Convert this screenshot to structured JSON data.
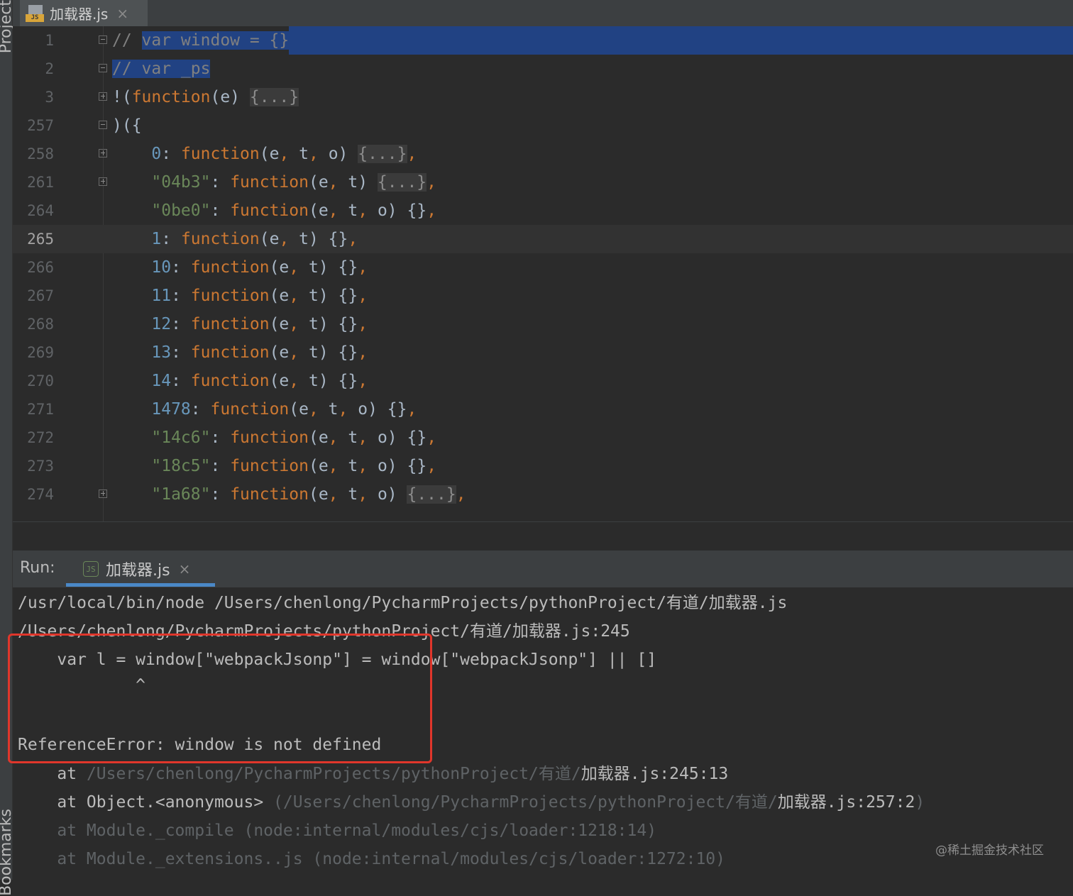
{
  "sidebar": {
    "project_label": "Project",
    "bookmarks_label": "Bookmarks"
  },
  "editor_tab": {
    "icon": "js-file-icon",
    "icon_badge": "JS",
    "filename": "加载器.js"
  },
  "editor": {
    "lines": [
      {
        "num": "1",
        "fold": "minus"
      },
      {
        "num": "2",
        "fold": "minus"
      },
      {
        "num": "3",
        "fold": "plus"
      },
      {
        "num": "257",
        "fold": "minus"
      },
      {
        "num": "258",
        "fold": "plus"
      },
      {
        "num": "261",
        "fold": "plus"
      },
      {
        "num": "264",
        "fold": ""
      },
      {
        "num": "265",
        "fold": "",
        "current": true
      },
      {
        "num": "266",
        "fold": ""
      },
      {
        "num": "267",
        "fold": ""
      },
      {
        "num": "268",
        "fold": ""
      },
      {
        "num": "269",
        "fold": ""
      },
      {
        "num": "270",
        "fold": ""
      },
      {
        "num": "271",
        "fold": ""
      },
      {
        "num": "272",
        "fold": ""
      },
      {
        "num": "273",
        "fold": ""
      },
      {
        "num": "274",
        "fold": "plus"
      }
    ],
    "code": {
      "l1": [
        "// ",
        "var window = {}"
      ],
      "l2": [
        "// var _ps"
      ],
      "l3": [
        "!(",
        "function",
        "(e) ",
        "{...}"
      ],
      "l257": [
        ")({"
      ],
      "l258": [
        "    ",
        "0",
        ": ",
        "function",
        "(e",
        ",",
        " t",
        ",",
        " o) ",
        "{...}",
        ","
      ],
      "l261": [
        "    ",
        "\"04b3\"",
        ": ",
        "function",
        "(e",
        ",",
        " t) ",
        "{...}",
        ","
      ],
      "l264": [
        "    ",
        "\"0be0\"",
        ": ",
        "function",
        "(e",
        ",",
        " t",
        ",",
        " o) {}",
        ","
      ],
      "l265": [
        "    ",
        "1",
        ": ",
        "function",
        "(e",
        ",",
        " t) {}",
        ","
      ],
      "l266": [
        "    ",
        "10",
        ": ",
        "function",
        "(e",
        ",",
        " t) {}",
        ","
      ],
      "l267": [
        "    ",
        "11",
        ": ",
        "function",
        "(e",
        ",",
        " t) {}",
        ","
      ],
      "l268": [
        "    ",
        "12",
        ": ",
        "function",
        "(e",
        ",",
        " t) {}",
        ","
      ],
      "l269": [
        "    ",
        "13",
        ": ",
        "function",
        "(e",
        ",",
        " t) {}",
        ","
      ],
      "l270": [
        "    ",
        "14",
        ": ",
        "function",
        "(e",
        ",",
        " t) {}",
        ","
      ],
      "l271": [
        "    ",
        "1478",
        ": ",
        "function",
        "(e",
        ",",
        " t",
        ",",
        " o) {}",
        ","
      ],
      "l272": [
        "    ",
        "\"14c6\"",
        ": ",
        "function",
        "(e",
        ",",
        " t",
        ",",
        " o) {}",
        ","
      ],
      "l273": [
        "    ",
        "\"18c5\"",
        ": ",
        "function",
        "(e",
        ",",
        " t",
        ",",
        " o) {}",
        ","
      ],
      "l274": [
        "    ",
        "\"1a68\"",
        ": ",
        "function",
        "(e",
        ",",
        " t",
        ",",
        " o) ",
        "{...}",
        ","
      ]
    }
  },
  "run": {
    "title": "Run:",
    "tab_label": "加载器.js",
    "tab_icon": "node-js-icon",
    "tab_icon_text": "JS",
    "console": [
      "/usr/local/bin/node /Users/chenlong/PycharmProjects/pythonProject/有道/加载器.js",
      "/Users/chenlong/PycharmProjects/pythonProject/有道/加载器.js:245",
      "    var l = window[\"webpackJsonp\"] = window[\"webpackJsonp\"] || []",
      "            ^",
      "",
      "ReferenceError: window is not defined",
      "    at ",
      "/Users/chenlong/PycharmProjects/pythonProject/有道/",
      "加载器.js:245:13",
      "    at Object.<anonymous> ",
      "(/Users/chenlong/PycharmProjects/pythonProject/有道/",
      "加载器.js:257:2",
      ")",
      "    at Module._compile (node:internal/modules/cjs/loader:1218:14)",
      "    at Module._extensions..js (node:internal/modules/cjs/loader:1272:10)"
    ]
  },
  "watermark": "@稀土掘金技术社区",
  "colors": {
    "selection": "#214283",
    "keyword": "#cc7832",
    "string": "#6a8759",
    "number": "#6897bb",
    "error_box": "#e0362b",
    "tab_underline": "#4a88c7"
  }
}
